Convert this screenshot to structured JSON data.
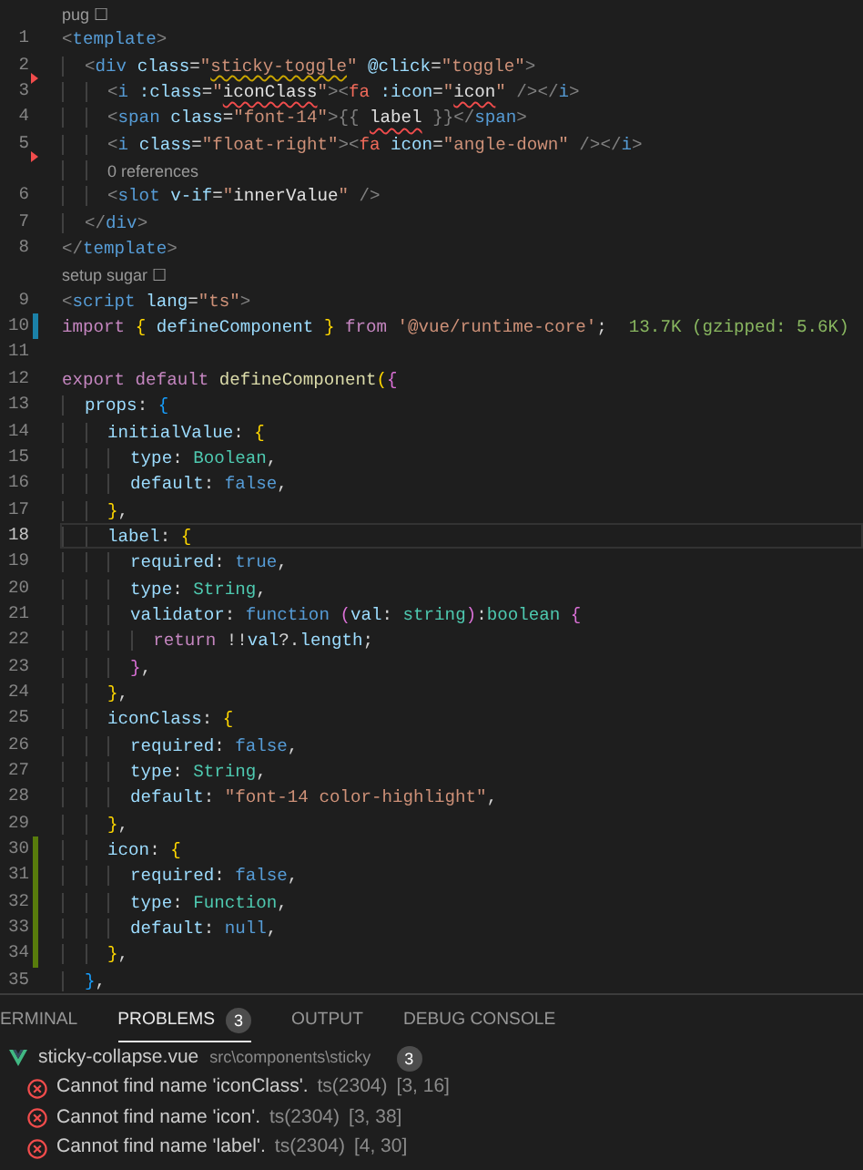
{
  "editor": {
    "lines": [
      {
        "kind": "codelens",
        "text": "pug ☐"
      },
      {
        "kind": "code",
        "number": "1",
        "current": false,
        "tokens": [
          {
            "text": "<",
            "kind": "punct"
          },
          {
            "text": "template",
            "kind": "tag"
          },
          {
            "text": ">",
            "kind": "punct"
          }
        ]
      },
      {
        "kind": "code",
        "number": "2",
        "current": false,
        "color": "#f14c4c",
        "tokens": [
          {
            "text": "  <",
            "kind": "punct"
          },
          {
            "text": "div",
            "kind": "tag"
          },
          {
            "text": " class",
            "kind": "attr"
          },
          {
            "text": "=",
            "kind": "text"
          },
          {
            "text": "\"",
            "kind": "string"
          },
          {
            "text": "sticky-toggle",
            "kind": "string",
            "warning": true
          },
          {
            "text": "\"",
            "kind": "string"
          },
          {
            "text": " @click",
            "kind": "attr"
          },
          {
            "text": "=",
            "kind": "text"
          },
          {
            "text": "\"toggle\"",
            "kind": "string"
          },
          {
            "text": ">",
            "kind": "punct"
          }
        ]
      },
      {
        "kind": "code",
        "number": "3",
        "current": false,
        "tokens": [
          {
            "text": "    <",
            "kind": "punct"
          },
          {
            "text": "i",
            "kind": "tag"
          },
          {
            "text": " :class",
            "kind": "attr"
          },
          {
            "text": "=",
            "kind": "text"
          },
          {
            "text": "\"",
            "kind": "string"
          },
          {
            "text": "iconClass",
            "kind": "expr",
            "error": true
          },
          {
            "text": "\"",
            "kind": "string"
          },
          {
            "text": ">",
            "kind": "punct"
          },
          {
            "text": "<",
            "kind": "punct"
          },
          {
            "text": "fa",
            "kind": "component"
          },
          {
            "text": " :icon",
            "kind": "attr"
          },
          {
            "text": "=",
            "kind": "text"
          },
          {
            "text": "\"",
            "kind": "string"
          },
          {
            "text": "icon",
            "kind": "expr",
            "error": true
          },
          {
            "text": "\"",
            "kind": "string"
          },
          {
            "text": " /></",
            "kind": "punct"
          },
          {
            "text": "i",
            "kind": "tag"
          },
          {
            "text": ">",
            "kind": "punct"
          }
        ]
      },
      {
        "kind": "code",
        "number": "4",
        "current": false,
        "tokens": [
          {
            "text": "    <",
            "kind": "punct"
          },
          {
            "text": "span",
            "kind": "tag"
          },
          {
            "text": " class",
            "kind": "attr"
          },
          {
            "text": "=",
            "kind": "text"
          },
          {
            "text": "\"font-14\"",
            "kind": "string"
          },
          {
            "text": ">",
            "kind": "punct"
          },
          {
            "text": "{{ ",
            "kind": "punct"
          },
          {
            "text": "label",
            "kind": "expr",
            "error": true
          },
          {
            "text": " }}",
            "kind": "punct"
          },
          {
            "text": "</",
            "kind": "punct"
          },
          {
            "text": "span",
            "kind": "tag"
          },
          {
            "text": ">",
            "kind": "punct"
          }
        ]
      },
      {
        "kind": "code",
        "number": "5",
        "current": false,
        "color": "#f14c4c",
        "tokens": [
          {
            "text": "    <",
            "kind": "punct"
          },
          {
            "text": "i",
            "kind": "tag"
          },
          {
            "text": " class",
            "kind": "attr"
          },
          {
            "text": "=",
            "kind": "text"
          },
          {
            "text": "\"float-right\"",
            "kind": "string"
          },
          {
            "text": ">",
            "kind": "punct"
          },
          {
            "text": "<",
            "kind": "punct"
          },
          {
            "text": "fa",
            "kind": "component"
          },
          {
            "text": " icon",
            "kind": "attr"
          },
          {
            "text": "=",
            "kind": "text"
          },
          {
            "text": "\"angle-down\"",
            "kind": "string"
          },
          {
            "text": " /></",
            "kind": "punct"
          },
          {
            "text": "i",
            "kind": "tag"
          },
          {
            "text": ">",
            "kind": "punct"
          }
        ]
      },
      {
        "kind": "codelens",
        "text": "0 references"
      },
      {
        "kind": "code",
        "number": "6",
        "current": false,
        "tokens": [
          {
            "text": "    <",
            "kind": "punct"
          },
          {
            "text": "slot",
            "kind": "tag"
          },
          {
            "text": " v-if",
            "kind": "attr"
          },
          {
            "text": "=",
            "kind": "text"
          },
          {
            "text": "\"",
            "kind": "string"
          },
          {
            "text": "innerValue",
            "kind": "expr"
          },
          {
            "text": "\"",
            "kind": "string"
          },
          {
            "text": " />",
            "kind": "punct"
          }
        ]
      },
      {
        "kind": "code",
        "number": "7",
        "current": false,
        "tokens": [
          {
            "text": "  </",
            "kind": "punct"
          },
          {
            "text": "div",
            "kind": "tag"
          },
          {
            "text": ">",
            "kind": "punct"
          }
        ]
      },
      {
        "kind": "code",
        "number": "8",
        "current": false,
        "tokens": [
          {
            "text": "</",
            "kind": "punct"
          },
          {
            "text": "template",
            "kind": "tag"
          },
          {
            "text": ">",
            "kind": "punct"
          }
        ]
      },
      {
        "kind": "codelens",
        "text": "setup sugar ☐"
      },
      {
        "kind": "code",
        "number": "9",
        "current": false,
        "tokens": [
          {
            "text": "<",
            "kind": "punct"
          },
          {
            "text": "script",
            "kind": "tag"
          },
          {
            "text": " lang",
            "kind": "attr"
          },
          {
            "text": "=",
            "kind": "text"
          },
          {
            "text": "\"ts\"",
            "kind": "string"
          },
          {
            "text": ">",
            "kind": "punct"
          }
        ]
      },
      {
        "kind": "code",
        "number": "10",
        "current": false,
        "color": "#1b81a8",
        "hint": "13.7K (gzipped: 5.6K)",
        "tokens": [
          {
            "text": "import ",
            "kind": "keyword"
          },
          {
            "text": "{",
            "kind": "bracket1"
          },
          {
            "text": " defineComponent ",
            "kind": "var"
          },
          {
            "text": "}",
            "kind": "bracket1"
          },
          {
            "text": " from ",
            "kind": "keyword"
          },
          {
            "text": "'@vue/runtime-core'",
            "kind": "string"
          },
          {
            "text": ";",
            "kind": "text"
          }
        ]
      },
      {
        "kind": "code",
        "number": "11",
        "current": false
      },
      {
        "kind": "code",
        "number": "12",
        "current": false,
        "tokens": [
          {
            "text": "export default ",
            "kind": "keyword"
          },
          {
            "text": "defineComponent",
            "kind": "func"
          },
          {
            "text": "(",
            "kind": "bracket1"
          },
          {
            "text": "{",
            "kind": "bracket2"
          }
        ]
      },
      {
        "kind": "code",
        "number": "13",
        "current": false,
        "tokens": [
          {
            "text": "  props",
            "kind": "prop"
          },
          {
            "text": ": ",
            "kind": "text"
          },
          {
            "text": "{",
            "kind": "bracket3"
          }
        ]
      },
      {
        "kind": "code",
        "number": "14",
        "current": false,
        "tokens": [
          {
            "text": "    initialValue",
            "kind": "prop"
          },
          {
            "text": ": ",
            "kind": "text"
          },
          {
            "text": "{",
            "kind": "bracket1"
          }
        ]
      },
      {
        "kind": "code",
        "number": "15",
        "current": false,
        "tokens": [
          {
            "text": "      type",
            "kind": "prop"
          },
          {
            "text": ": ",
            "kind": "text"
          },
          {
            "text": "Boolean",
            "kind": "type"
          },
          {
            "text": ",",
            "kind": "text"
          }
        ]
      },
      {
        "kind": "code",
        "number": "16",
        "current": false,
        "tokens": [
          {
            "text": "      default",
            "kind": "prop"
          },
          {
            "text": ": ",
            "kind": "text"
          },
          {
            "text": "false",
            "kind": "const"
          },
          {
            "text": ",",
            "kind": "text"
          }
        ]
      },
      {
        "kind": "code",
        "number": "17",
        "current": false,
        "tokens": [
          {
            "text": "    }",
            "kind": "bracket1"
          },
          {
            "text": ",",
            "kind": "text"
          }
        ]
      },
      {
        "kind": "code",
        "number": "18",
        "current": true,
        "tokens": [
          {
            "text": "    label",
            "kind": "prop"
          },
          {
            "text": ": ",
            "kind": "text"
          },
          {
            "text": "{",
            "kind": "bracket1"
          }
        ]
      },
      {
        "kind": "code",
        "number": "19",
        "current": false,
        "tokens": [
          {
            "text": "      required",
            "kind": "prop"
          },
          {
            "text": ": ",
            "kind": "text"
          },
          {
            "text": "true",
            "kind": "const"
          },
          {
            "text": ",",
            "kind": "text"
          }
        ]
      },
      {
        "kind": "code",
        "number": "20",
        "current": false,
        "tokens": [
          {
            "text": "      type",
            "kind": "prop"
          },
          {
            "text": ": ",
            "kind": "text"
          },
          {
            "text": "String",
            "kind": "type"
          },
          {
            "text": ",",
            "kind": "text"
          }
        ]
      },
      {
        "kind": "code",
        "number": "21",
        "current": false,
        "tokens": [
          {
            "text": "      validator",
            "kind": "prop"
          },
          {
            "text": ": ",
            "kind": "text"
          },
          {
            "text": "function ",
            "kind": "const"
          },
          {
            "text": "(",
            "kind": "bracket2"
          },
          {
            "text": "val",
            "kind": "var"
          },
          {
            "text": ": ",
            "kind": "text"
          },
          {
            "text": "string",
            "kind": "type"
          },
          {
            "text": ")",
            "kind": "bracket2"
          },
          {
            "text": ":",
            "kind": "text"
          },
          {
            "text": "boolean ",
            "kind": "type"
          },
          {
            "text": "{",
            "kind": "bracket2"
          }
        ]
      },
      {
        "kind": "code",
        "number": "22",
        "current": false,
        "tokens": [
          {
            "text": "        return",
            "kind": "keyword"
          },
          {
            "text": " !!",
            "kind": "text"
          },
          {
            "text": "val",
            "kind": "var"
          },
          {
            "text": "?.",
            "kind": "text"
          },
          {
            "text": "length",
            "kind": "prop"
          },
          {
            "text": ";",
            "kind": "text"
          }
        ]
      },
      {
        "kind": "code",
        "number": "23",
        "current": false,
        "tokens": [
          {
            "text": "      }",
            "kind": "bracket2"
          },
          {
            "text": ",",
            "kind": "text"
          }
        ]
      },
      {
        "kind": "code",
        "number": "24",
        "current": false,
        "tokens": [
          {
            "text": "    }",
            "kind": "bracket1"
          },
          {
            "text": ",",
            "kind": "text"
          }
        ]
      },
      {
        "kind": "code",
        "number": "25",
        "current": false,
        "tokens": [
          {
            "text": "    iconClass",
            "kind": "prop"
          },
          {
            "text": ": ",
            "kind": "text"
          },
          {
            "text": "{",
            "kind": "bracket1"
          }
        ]
      },
      {
        "kind": "code",
        "number": "26",
        "current": false,
        "tokens": [
          {
            "text": "      required",
            "kind": "prop"
          },
          {
            "text": ": ",
            "kind": "text"
          },
          {
            "text": "false",
            "kind": "const"
          },
          {
            "text": ",",
            "kind": "text"
          }
        ]
      },
      {
        "kind": "code",
        "number": "27",
        "current": false,
        "tokens": [
          {
            "text": "      type",
            "kind": "prop"
          },
          {
            "text": ": ",
            "kind": "text"
          },
          {
            "text": "String",
            "kind": "type"
          },
          {
            "text": ",",
            "kind": "text"
          }
        ]
      },
      {
        "kind": "code",
        "number": "28",
        "current": false,
        "tokens": [
          {
            "text": "      default",
            "kind": "prop"
          },
          {
            "text": ": ",
            "kind": "text"
          },
          {
            "text": "\"font-14 color-highlight\"",
            "kind": "string"
          },
          {
            "text": ",",
            "kind": "text"
          }
        ]
      },
      {
        "kind": "code",
        "number": "29",
        "current": false,
        "tokens": [
          {
            "text": "    }",
            "kind": "bracket1"
          },
          {
            "text": ",",
            "kind": "text"
          }
        ]
      },
      {
        "kind": "code",
        "number": "30",
        "current": false,
        "color": "#587c0c",
        "tokens": [
          {
            "text": "    icon",
            "kind": "prop"
          },
          {
            "text": ": ",
            "kind": "text"
          },
          {
            "text": "{",
            "kind": "bracket1"
          }
        ]
      },
      {
        "kind": "code",
        "number": "31",
        "current": false,
        "color": "#587c0c",
        "tokens": [
          {
            "text": "      required",
            "kind": "prop"
          },
          {
            "text": ": ",
            "kind": "text"
          },
          {
            "text": "false",
            "kind": "const"
          },
          {
            "text": ",",
            "kind": "text"
          }
        ]
      },
      {
        "kind": "code",
        "number": "32",
        "current": false,
        "color": "#587c0c",
        "tokens": [
          {
            "text": "      type",
            "kind": "prop"
          },
          {
            "text": ": ",
            "kind": "text"
          },
          {
            "text": "Function",
            "kind": "type"
          },
          {
            "text": ",",
            "kind": "text"
          }
        ]
      },
      {
        "kind": "code",
        "number": "33",
        "current": false,
        "color": "#587c0c",
        "tokens": [
          {
            "text": "      default",
            "kind": "prop"
          },
          {
            "text": ": ",
            "kind": "text"
          },
          {
            "text": "null",
            "kind": "const"
          },
          {
            "text": ",",
            "kind": "text"
          }
        ]
      },
      {
        "kind": "code",
        "number": "34",
        "current": false,
        "color": "#587c0c",
        "tokens": [
          {
            "text": "    }",
            "kind": "bracket1"
          },
          {
            "text": ",",
            "kind": "text"
          }
        ]
      },
      {
        "kind": "code",
        "number": "35",
        "current": false,
        "tokens": [
          {
            "text": "  }",
            "kind": "bracket3"
          },
          {
            "text": ",",
            "kind": "text"
          }
        ]
      }
    ]
  },
  "panel": {
    "tabs": [
      {
        "label": "ERMINAL",
        "selected": false
      },
      {
        "label": "PROBLEMS",
        "selected": true,
        "badge": "3"
      },
      {
        "label": "OUTPUT",
        "selected": false
      },
      {
        "label": "DEBUG CONSOLE",
        "selected": false
      }
    ],
    "file": {
      "name": "sticky-collapse.vue",
      "path": "src\\components\\sticky",
      "count": "3"
    },
    "problems": [
      {
        "message": "Cannot find name 'iconClass'.",
        "source": "ts(2304)",
        "position": "[3, 16]"
      },
      {
        "message": "Cannot find name 'icon'.",
        "source": "ts(2304)",
        "position": "[3, 38]"
      },
      {
        "message": "Cannot find name 'label'.",
        "source": "ts(2304)",
        "position": "[4, 30]"
      }
    ]
  }
}
